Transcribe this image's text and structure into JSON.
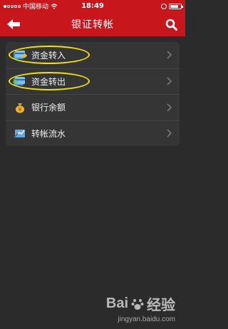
{
  "status_bar": {
    "carrier": "中国移动",
    "time": "18:49",
    "battery_level": 0.8
  },
  "nav": {
    "title": "银证转帐"
  },
  "menu": {
    "items": [
      {
        "label": "资金转入",
        "icon": "transfer-in-icon",
        "highlighted": true
      },
      {
        "label": "资金转出",
        "icon": "transfer-out-icon",
        "highlighted": true
      },
      {
        "label": "银行余额",
        "icon": "money-bag-icon",
        "highlighted": false
      },
      {
        "label": "转帐流水",
        "icon": "transfer-history-icon",
        "highlighted": false
      }
    ]
  },
  "watermark": {
    "brand_a": "Bai",
    "brand_b": "经验",
    "sub": "jingyan.baidu.com"
  },
  "colors": {
    "brand_red": "#c8161d",
    "highlight": "#f2e300",
    "background": "#2b2b2b"
  }
}
